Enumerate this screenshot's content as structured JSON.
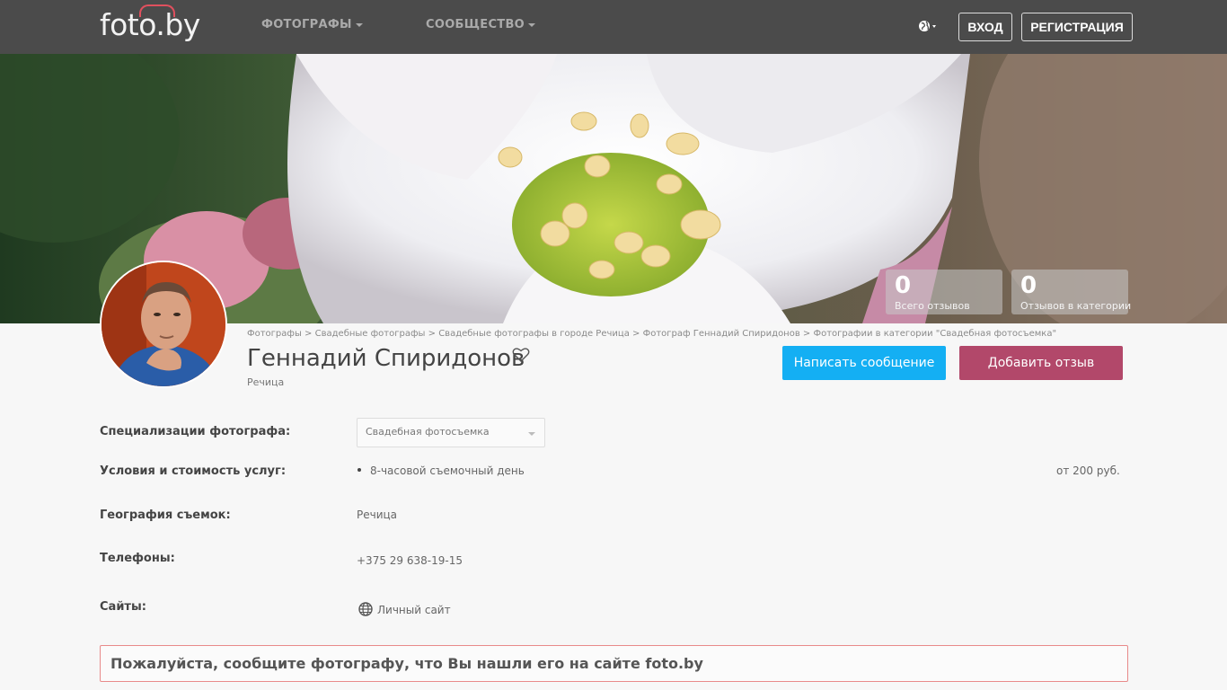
{
  "header": {
    "logo": "foto.by",
    "nav": [
      {
        "label": "ФОТОГРАФЫ"
      },
      {
        "label": "СООБЩЕСТВО"
      }
    ],
    "login_label": "ВХОД",
    "register_label": "РЕГИСТРАЦИЯ",
    "language_icon": "globe-icon"
  },
  "stats": [
    {
      "value": "0",
      "label": "Всего отзывов"
    },
    {
      "value": "0",
      "label": "Отзывов в категории"
    }
  ],
  "breadcrumb": [
    "Фотографы",
    "Свадебные фотографы",
    "Свадебные фотографы в городе Речица",
    "Фотограф Геннадий Спиридонов",
    "Фотографии в категории \"Свадебная фотосъемка\""
  ],
  "breadcrumb_separator": ">",
  "profile": {
    "name": "Геннадий Спиридонов",
    "city": "Речица",
    "favorite_icon": "heart-icon"
  },
  "actions": {
    "message_label": "Написать сообщение",
    "review_label": "Добавить отзыв"
  },
  "details": {
    "specialization_label": "Специализации фотографа:",
    "specialization_value": "Свадебная фотосъемка",
    "services_label": "Условия и стоимость услуг:",
    "service_item": "8-часовой съемочный день",
    "service_price": "от 200 руб.",
    "geography_label": "География съемок:",
    "geography_value": "Речица",
    "phones_label": "Телефоны:",
    "phone_value": "+375 29 638-19-15",
    "sites_label": "Сайты:",
    "site_link": "Личный сайт"
  },
  "notice": "Пожалуйста, сообщите фотографу, что Вы нашли его на сайте foto.by",
  "colors": {
    "header_bg": "#4b4b4b",
    "primary_button": "#14aff3",
    "review_button": "#b2486a",
    "notice_border": "#e88a8a",
    "logo_accent": "#e0505e"
  }
}
